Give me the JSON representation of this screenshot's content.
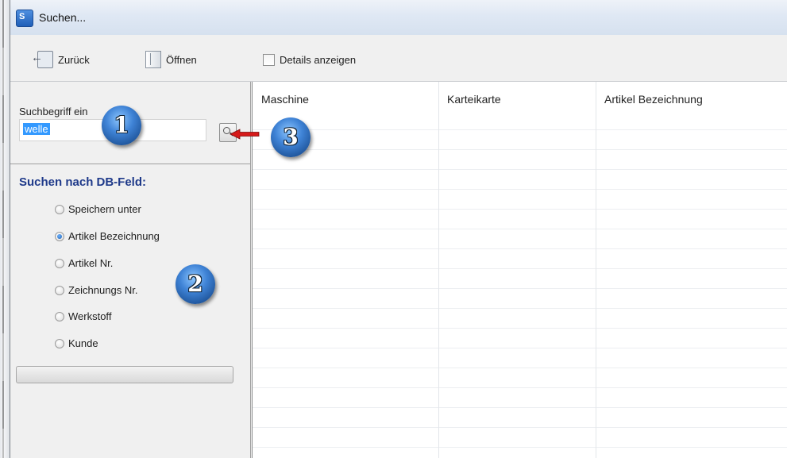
{
  "window": {
    "title": "Suchen...",
    "icon": "search-app-icon"
  },
  "toolbar": {
    "back_label": "Zurück",
    "open_label": "Öffnen",
    "details_label": "Details anzeigen"
  },
  "search": {
    "label": "Suchbegriff ein",
    "value": "welle"
  },
  "db_section": {
    "heading": "Suchen nach DB-Feld:",
    "options": [
      "Speichern unter",
      "Artikel Bezeichnung",
      "Artikel Nr.",
      "Zeichnungs Nr.",
      "Werkstoff",
      "Kunde"
    ],
    "selected": "Artikel Bezeichnung"
  },
  "grid": {
    "columns": [
      "Maschine",
      "Karteikarte",
      "Artikel Bezeichnung"
    ]
  },
  "annotations": [
    "1",
    "2",
    "3"
  ],
  "colors": {
    "accent": "#1f3a8a",
    "selection": "#3399ff",
    "callout_arrow": "#d61a1a"
  }
}
